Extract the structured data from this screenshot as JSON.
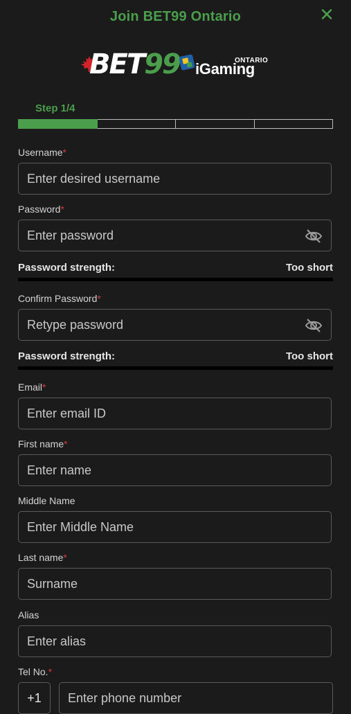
{
  "header": {
    "title": "Join BET99 Ontario",
    "close_icon": "close-icon"
  },
  "logos": {
    "bet_text": "BET",
    "bet_num": "99",
    "ontario": "ONTARIO",
    "igaming": "iGaming"
  },
  "step": {
    "label": "Step 1/4",
    "current": 1,
    "total": 4
  },
  "colors": {
    "accent": "#4a9e4c",
    "required": "#d23b3b",
    "background": "#1b1b1b"
  },
  "form": {
    "username": {
      "label": "Username",
      "placeholder": "Enter desired username"
    },
    "password": {
      "label": "Password",
      "placeholder": "Enter password"
    },
    "password_strength": {
      "label": "Password strength:",
      "value": "Too short"
    },
    "confirm_password": {
      "label": "Confirm Password",
      "placeholder": "Retype password"
    },
    "confirm_strength": {
      "label": "Password strength:",
      "value": "Too short"
    },
    "email": {
      "label": "Email",
      "placeholder": "Enter email ID"
    },
    "first_name": {
      "label": "First name",
      "placeholder": "Enter name"
    },
    "middle_name": {
      "label": "Middle Name",
      "placeholder": "Enter Middle Name"
    },
    "last_name": {
      "label": "Last name",
      "placeholder": "Surname"
    },
    "alias": {
      "label": "Alias",
      "placeholder": "Enter alias"
    },
    "tel": {
      "label": "Tel No.",
      "prefix": "+1",
      "placeholder": "Enter phone number"
    },
    "required_mark": "*"
  }
}
